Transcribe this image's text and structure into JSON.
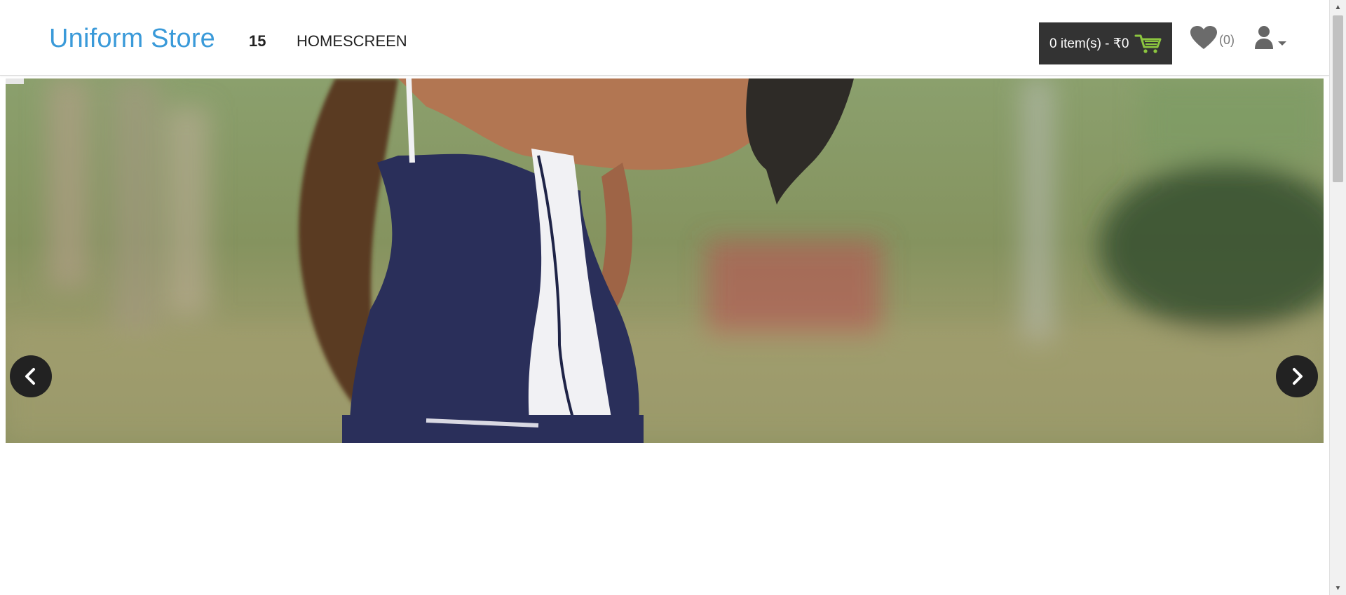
{
  "header": {
    "brand": "Uniform Store",
    "nav": [
      {
        "label": "15"
      },
      {
        "label": "HOMESCREEN"
      }
    ],
    "cart": {
      "label": "0 item(s) - ₹0"
    },
    "wishlist": {
      "count": "(0)"
    },
    "colors": {
      "brand": "#3a9ad9",
      "cart_bg": "#333333",
      "cart_icon": "#8cc63f"
    }
  },
  "hero": {
    "image": "softball-player-photo",
    "prev_icon": "chevron-left-icon",
    "next_icon": "chevron-right-icon"
  },
  "icons": {
    "cart": "cart-icon",
    "wishlist": "heart-icon",
    "user": "user-icon",
    "caret": "caret-down-icon"
  }
}
